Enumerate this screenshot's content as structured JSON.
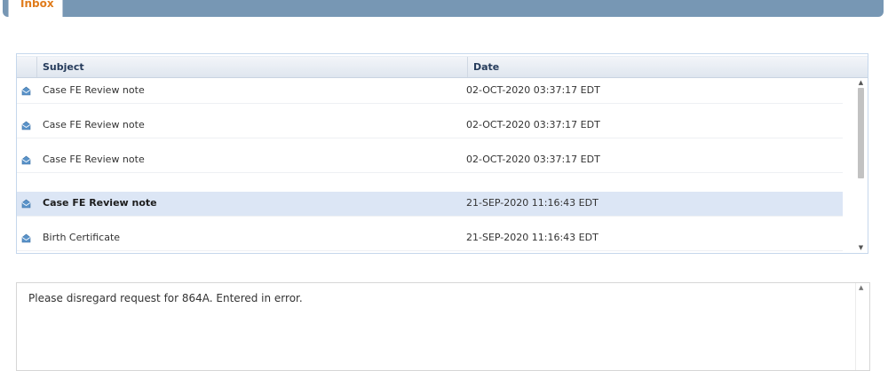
{
  "tabs": {
    "active_label": "Inbox"
  },
  "grid": {
    "columns": {
      "subject": "Subject",
      "date": "Date"
    },
    "rows": [
      {
        "subject": "Case FE Review note",
        "date": "02-OCT-2020 03:37:17 EDT",
        "selected": false,
        "icon": "envelope-open-icon"
      },
      {
        "subject": "Case FE Review note",
        "date": "02-OCT-2020 03:37:17 EDT",
        "selected": false,
        "icon": "envelope-open-icon"
      },
      {
        "subject": "Case FE Review note",
        "date": "02-OCT-2020 03:37:17 EDT",
        "selected": false,
        "icon": "envelope-open-icon"
      },
      {
        "subject": "Case FE Review note",
        "date": "21-SEP-2020 11:16:43 EDT",
        "selected": true,
        "icon": "envelope-open-icon"
      },
      {
        "subject": "Birth Certificate",
        "date": "21-SEP-2020 11:16:43 EDT",
        "selected": false,
        "icon": "envelope-open-icon"
      }
    ]
  },
  "message": {
    "body": "Please disregard request for 864A. Entered in error."
  },
  "colors": {
    "tab_bar": "#7797b4",
    "tab_label": "#e07c1c",
    "selected_row": "#dce6f5",
    "header_text": "#253b5b"
  }
}
